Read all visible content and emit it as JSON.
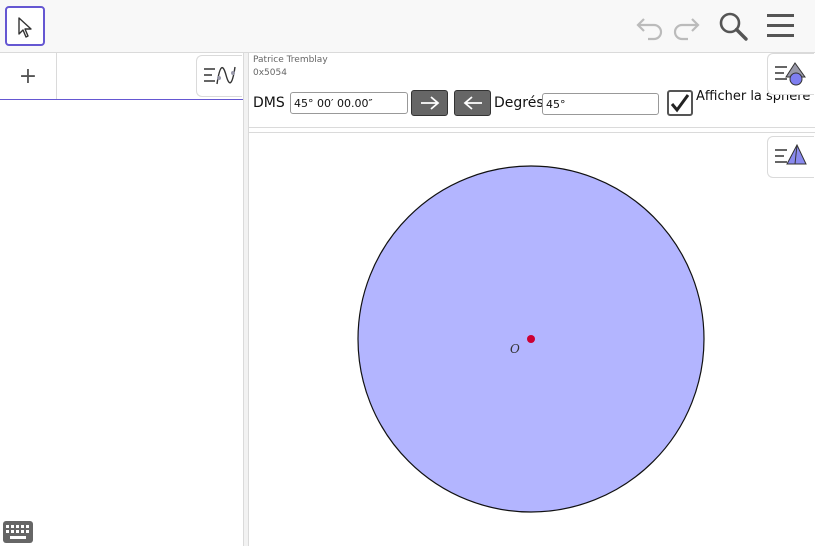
{
  "toolbar": {
    "tools": [
      "select-tool",
      "undo",
      "redo",
      "search",
      "menu"
    ]
  },
  "algebra": {
    "add_symbol": "+"
  },
  "graphics": {
    "author": "Patrice Tremblay",
    "author_code": "0x5054",
    "dms_label": "DMS",
    "dms_value": "45° 00′ 00.00″",
    "degrees_label": "Degrés",
    "degrees_value": "45°",
    "checkbox_label": "Afficher la sphère",
    "checkbox_checked": true,
    "center_label": "O",
    "sphere_color": "#b3b5ff",
    "point_color": "#cc0033"
  }
}
